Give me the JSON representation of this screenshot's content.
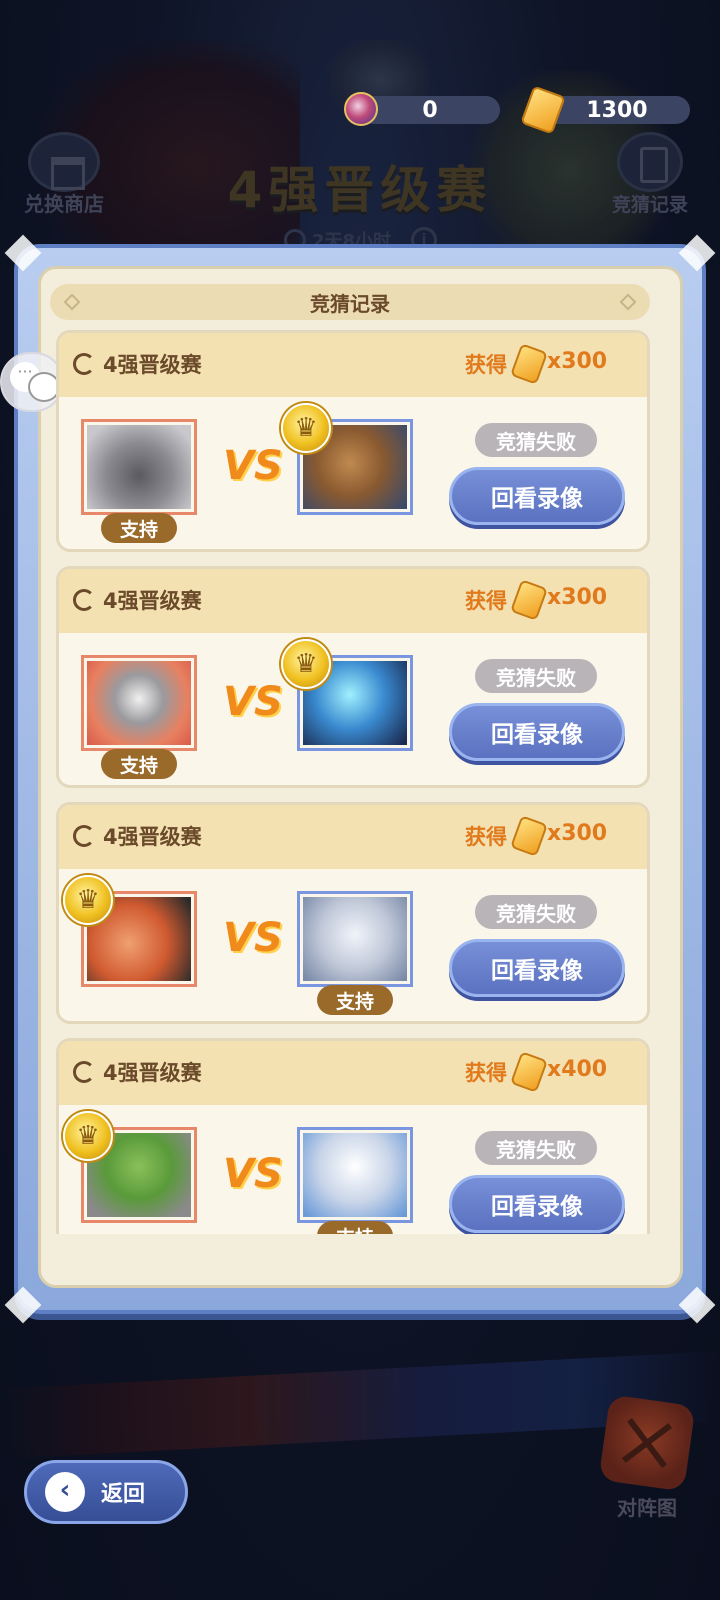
{
  "header": {
    "event_title": "4强晋级赛",
    "timer": "2天8小时",
    "currency": [
      {
        "icon": "gem-icon",
        "value": "0"
      },
      {
        "icon": "ticket-icon",
        "value": "1300"
      }
    ],
    "shop_label": "兑换商店",
    "record_label": "竞猜记录"
  },
  "panel": {
    "title": "竞猜记录"
  },
  "records": [
    {
      "match": "4强晋级赛",
      "reward_label": "获得",
      "reward_value": "x300",
      "left_art": "rock-beast",
      "right_art": "barbarian",
      "winner": "right",
      "supported": "left",
      "support_label": "支持",
      "vs": "VS",
      "result": "竞猜失败",
      "replay_label": "回看录像"
    },
    {
      "match": "4强晋级赛",
      "reward_label": "获得",
      "reward_value": "x300",
      "left_art": "shield-golem",
      "right_art": "ice-knight",
      "winner": "right",
      "supported": "left",
      "support_label": "支持",
      "vs": "VS",
      "result": "竞猜失败",
      "replay_label": "回看录像"
    },
    {
      "match": "4强晋级赛",
      "reward_label": "获得",
      "reward_value": "x300",
      "left_art": "leaf-beast",
      "right_art": "robot",
      "winner": "left",
      "supported": "right",
      "support_label": "支持",
      "vs": "VS",
      "result": "竞猜失败",
      "replay_label": "回看录像"
    },
    {
      "match": "4强晋级赛",
      "reward_label": "获得",
      "reward_value": "x400",
      "left_art": "grass-golem",
      "right_art": "griffin",
      "winner": "left",
      "supported": "right",
      "support_label": "支持",
      "vs": "VS",
      "result": "竞猜失败",
      "replay_label": "回看录像"
    }
  ],
  "footer": {
    "back_label": "返回",
    "lineup_label": "对阵图"
  },
  "colors": {
    "accent_orange": "#e07a1c",
    "button_blue": "#5a72c0",
    "panel_bg": "#f3eedc"
  }
}
